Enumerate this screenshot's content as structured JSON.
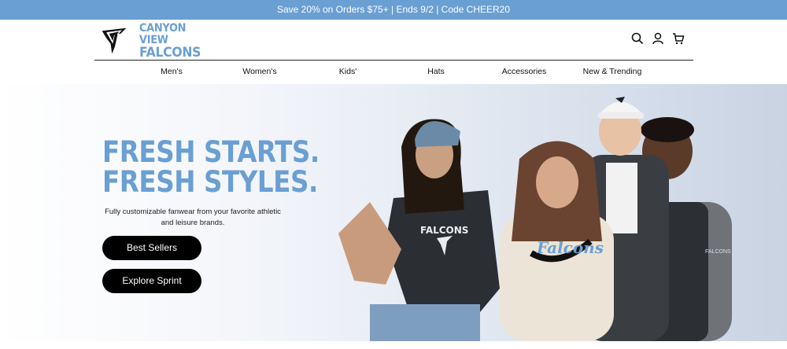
{
  "promo": {
    "text": "Save 20% on Orders $75+ | Ends 9/2 | Code CHEER20"
  },
  "header": {
    "brand_line1": "CANYON VIEW",
    "brand_line2": "FALCONS",
    "icons": [
      "search-icon",
      "account-icon",
      "cart-icon"
    ]
  },
  "nav": {
    "items": [
      "Men's",
      "Women's",
      "Kids'",
      "Hats",
      "Accessories",
      "New & Trending"
    ]
  },
  "hero": {
    "title_line1": "FRESH STARTS.",
    "title_line2": "FRESH STYLES.",
    "subtitle": "Fully customizable fanwear from your favorite athletic and leisure brands.",
    "buttons": [
      "Best Sellers",
      "Explore Sprint"
    ],
    "jersey_text": "FALCONS",
    "sweatshirt_text": "Falcons",
    "vest_text": "FALCONS"
  },
  "colors": {
    "accent": "#6a9fd3",
    "promo_bg": "#6a9fd3",
    "button_bg": "#000000"
  }
}
